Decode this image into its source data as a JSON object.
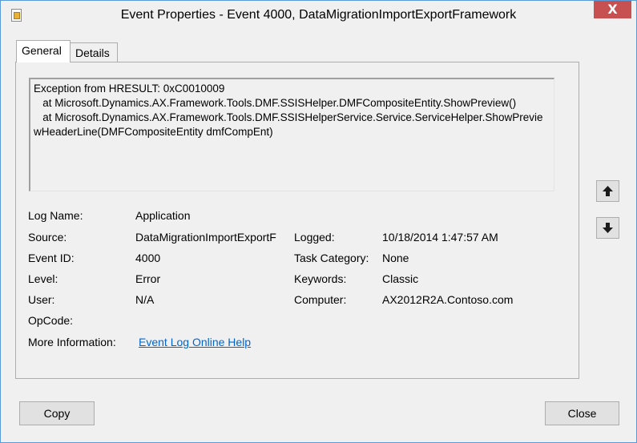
{
  "window": {
    "title": "Event Properties - Event 4000, DataMigrationImportExportFramework",
    "close_label": "X"
  },
  "tabs": [
    {
      "label": "General",
      "active": true
    },
    {
      "label": "Details",
      "active": false
    }
  ],
  "description": "Exception from HRESULT: 0xC0010009\n   at Microsoft.Dynamics.AX.Framework.Tools.DMF.SSISHelper.DMFCompositeEntity.ShowPreview()\n   at Microsoft.Dynamics.AX.Framework.Tools.DMF.SSISHelperService.Service.ServiceHelper.ShowPreviewHeaderLine(DMFCompositeEntity dmfCompEnt)",
  "fields": {
    "log_name": {
      "label": "Log Name:",
      "value": "Application"
    },
    "source": {
      "label": "Source:",
      "value": "DataMigrationImportExportF"
    },
    "logged": {
      "label": "Logged:",
      "value": "10/18/2014 1:47:57 AM"
    },
    "event_id": {
      "label": "Event ID:",
      "value": "4000"
    },
    "task_category": {
      "label": "Task Category:",
      "value": "None"
    },
    "level": {
      "label": "Level:",
      "value": "Error"
    },
    "keywords": {
      "label": "Keywords:",
      "value": "Classic"
    },
    "user": {
      "label": "User:",
      "value": "N/A"
    },
    "computer": {
      "label": "Computer:",
      "value": "AX2012R2A.Contoso.com"
    },
    "opcode": {
      "label": "OpCode:",
      "value": ""
    },
    "more_info": {
      "label": "More Information:",
      "link": "Event Log Online Help"
    }
  },
  "nav": {
    "up_icon": "arrow-up-icon",
    "down_icon": "arrow-down-icon"
  },
  "buttons": {
    "copy": "Copy",
    "close": "Close"
  },
  "colors": {
    "close_button": "#c75050",
    "link": "#0066cc"
  }
}
